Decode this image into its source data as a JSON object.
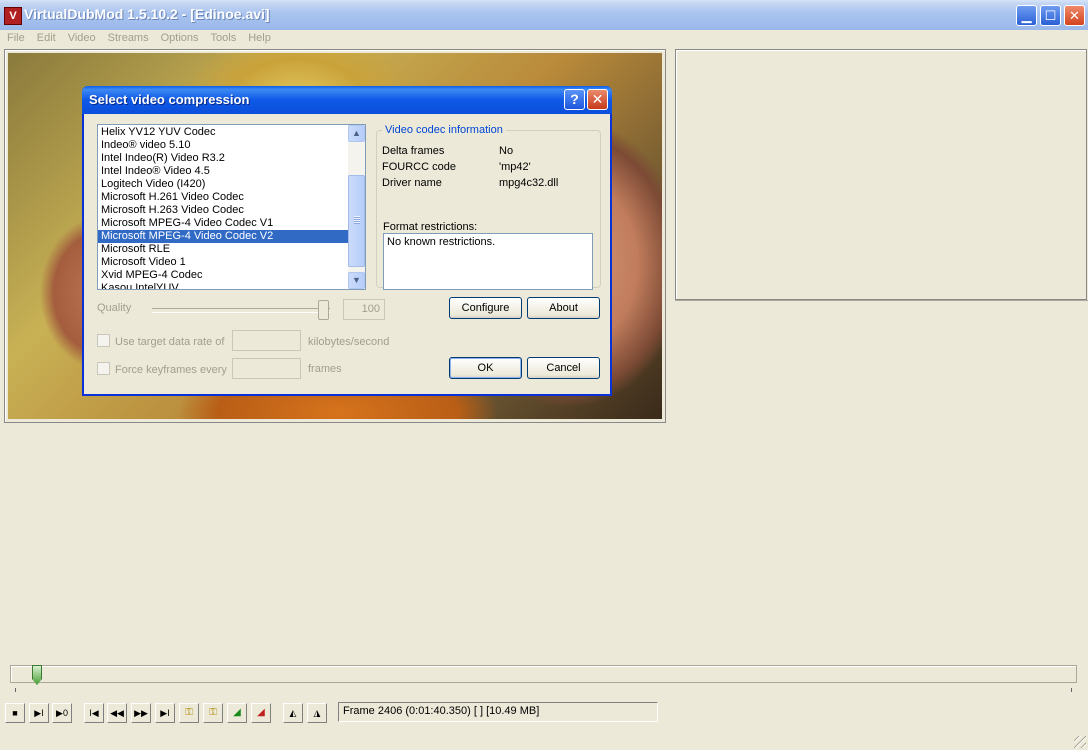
{
  "window": {
    "title": "VirtualDubMod 1.5.10.2 - [Edinoe.avi]",
    "min_glyph": "▁",
    "max_glyph": "☐",
    "close_glyph": "✕"
  },
  "menu": [
    "File",
    "Edit",
    "Video",
    "Streams",
    "Options",
    "Tools",
    "Help"
  ],
  "dialog": {
    "title": "Select video compression",
    "help_glyph": "?",
    "close_glyph": "✕",
    "codecs": [
      "Helix YV12 YUV Codec",
      "Indeo® video 5.10",
      "Intel Indeo(R) Video R3.2",
      "Intel Indeo® Video 4.5",
      "Logitech Video (I420)",
      "Microsoft H.261 Video Codec",
      "Microsoft H.263 Video Codec",
      "Microsoft MPEG-4 Video Codec V1",
      "Microsoft MPEG-4 Video Codec V2",
      "Microsoft RLE",
      "Microsoft Video 1",
      "Xvid MPEG-4 Codec",
      "Kasou IntelYUV"
    ],
    "selected_codec": "Microsoft MPEG-4 Video Codec V2",
    "info": {
      "legend": "Video codec information",
      "delta_label": "Delta frames",
      "delta_value": "No",
      "fourcc_label": "FOURCC code",
      "fourcc_value": "'mp42'",
      "driver_label": "Driver name",
      "driver_value": "mpg4c32.dll",
      "restrictions_label": "Format restrictions:",
      "restrictions_value": "No known restrictions."
    },
    "quality_label": "Quality",
    "quality_value": "100",
    "quality_level": 1.0,
    "configure_label": "Configure",
    "about_label": "About",
    "ok_label": "OK",
    "cancel_label": "Cancel",
    "target_rate_label": "Use target data rate of",
    "target_rate_unit": "kilobytes/second",
    "keyframes_label": "Force keyframes every",
    "keyframes_unit": "frames"
  },
  "status": {
    "frame_text": "Frame 2406 (0:01:40.350) [ ] [10.49 MB]"
  },
  "icons": {
    "scroll_up": "▲",
    "scroll_down": "▼",
    "toolbar": [
      "■",
      "▶I",
      "▶0",
      "I◀",
      "◀◀",
      "▶▶",
      "▶I",
      "⚿",
      "⚿",
      "◢",
      "◢",
      "◭",
      "◮"
    ]
  },
  "colors": {
    "selection": "#316ac5",
    "dialog_title": "#0b4fdc",
    "groupbox_legend": "#0046d5"
  }
}
